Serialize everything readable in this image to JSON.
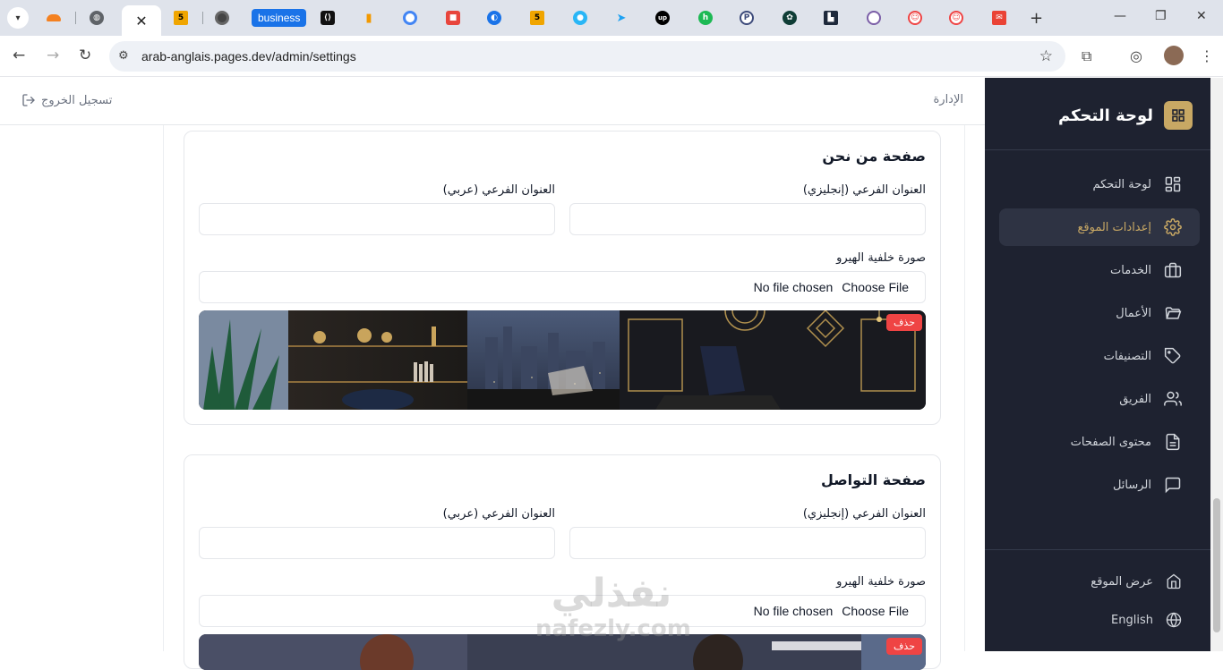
{
  "browser": {
    "business_tab": "business",
    "url": "arab-anglais.pages.dev/admin/settings",
    "tab_favicons": [
      "cloudflare-icon",
      "globe-icon",
      "active-tab",
      "w3-icon",
      "chrome-icon",
      "business",
      "code-icon",
      "analytics-icon",
      "google-icon",
      "app-icon",
      "app-icon",
      "w3-icon",
      "app-icon",
      "send-icon",
      "upwork-icon",
      "app-icon",
      "app-icon",
      "chatgpt-icon",
      "app-icon",
      "app-icon",
      "app-icon",
      "app-icon",
      "gmail-icon"
    ]
  },
  "sidebar": {
    "title": "لوحة التحكم",
    "items": [
      {
        "label": "لوحة التحكم",
        "icon": "dashboard-icon"
      },
      {
        "label": "إعدادات الموقع",
        "icon": "gear-icon",
        "active": true
      },
      {
        "label": "الخدمات",
        "icon": "briefcase-icon"
      },
      {
        "label": "الأعمال",
        "icon": "folder-icon"
      },
      {
        "label": "التصنيفات",
        "icon": "tag-icon"
      },
      {
        "label": "الفريق",
        "icon": "users-icon"
      },
      {
        "label": "محتوى الصفحات",
        "icon": "document-icon"
      },
      {
        "label": "الرسائل",
        "icon": "message-icon"
      }
    ],
    "footer": [
      {
        "label": "عرض الموقع",
        "icon": "home-icon"
      },
      {
        "label": "English",
        "icon": "globe-icon"
      }
    ],
    "accent": "#c8a864",
    "bg": "#1e2230"
  },
  "header": {
    "breadcrumb": "الإدارة",
    "logout": "تسجيل الخروج"
  },
  "about_card": {
    "title": "صفحة من نحن",
    "subtitle_en_label": "العنوان الفرعي (إنجليزي)",
    "subtitle_ar_label": "العنوان الفرعي (عربي)",
    "subtitle_en_value": "",
    "subtitle_ar_value": "",
    "hero_label": "صورة خلفية الهيرو",
    "choose_file": "Choose File",
    "no_file": "No file chosen",
    "delete": "حذف"
  },
  "contact_card": {
    "title": "صفحة التواصل",
    "subtitle_en_label": "العنوان الفرعي (إنجليزي)",
    "subtitle_ar_label": "العنوان الفرعي (عربي)",
    "subtitle_en_value": "",
    "subtitle_ar_value": "",
    "hero_label": "صورة خلفية الهيرو",
    "choose_file": "Choose File",
    "no_file": "No file chosen",
    "delete": "حذف"
  },
  "watermark": {
    "arabic": "نفذلي",
    "latin": "nafezly.com"
  }
}
